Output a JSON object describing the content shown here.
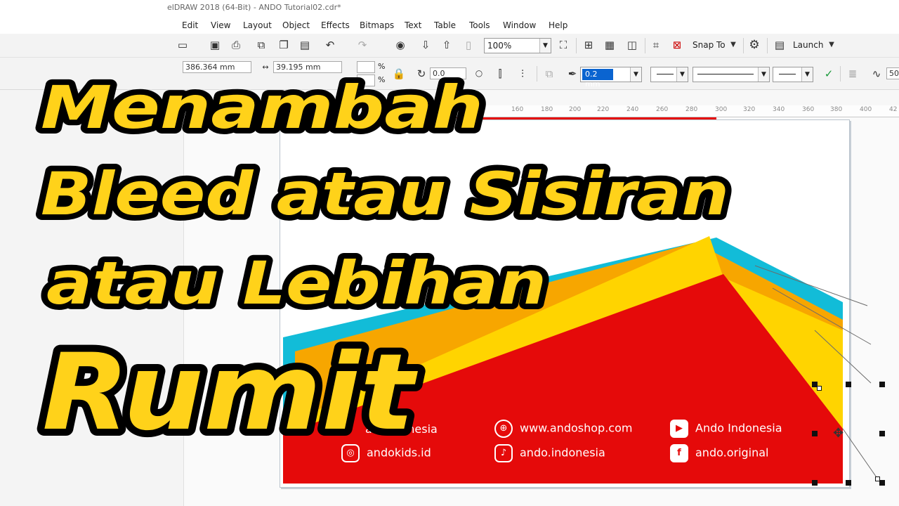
{
  "window": {
    "title": "elDRAW 2018 (64-Bit) - ANDO Tutorial02.cdr*"
  },
  "menu": [
    "Edit",
    "View",
    "Layout",
    "Object",
    "Effects",
    "Bitmaps",
    "Text",
    "Table",
    "Tools",
    "Window",
    "Help"
  ],
  "toolbar": {
    "zoom_value": "100%",
    "snap_label": "Snap To",
    "launch_label": "Launch"
  },
  "property_bar": {
    "x_value": "386.364 mm",
    "width_value": "39.195 mm",
    "scale_unit": "%",
    "rotation_value": "0.0",
    "outline_width": "0.2 mm",
    "partial_value": "50"
  },
  "ruler": {
    "labels": [
      "160",
      "180",
      "200",
      "220",
      "240",
      "260",
      "280",
      "300",
      "320",
      "340",
      "360",
      "380",
      "400",
      "42"
    ]
  },
  "artwork": {
    "social": [
      {
        "icon": "globe-icon",
        "label": "www.andoshop.com"
      },
      {
        "icon": "youtube-icon",
        "label": "Ando Indonesia"
      },
      {
        "icon": "instagram-icon",
        "label": "andokids.id"
      },
      {
        "icon": "tiktok-icon",
        "label": "ando.indonesia"
      },
      {
        "icon": "facebook-icon",
        "label": "ando.original"
      }
    ],
    "partial_label": "ar...ndonesia",
    "colors": {
      "red": "#e50a0a",
      "yellow": "#ffd400",
      "cyan": "#12bcd8",
      "orange": "#f7a600"
    }
  },
  "headline": {
    "line1": "Menambah",
    "line2": "Bleed atau Sisiran",
    "line3": "atau Lebihan",
    "line4": "Rumit",
    "fill_color": "#ffd21a",
    "outline_color": "#000000"
  }
}
